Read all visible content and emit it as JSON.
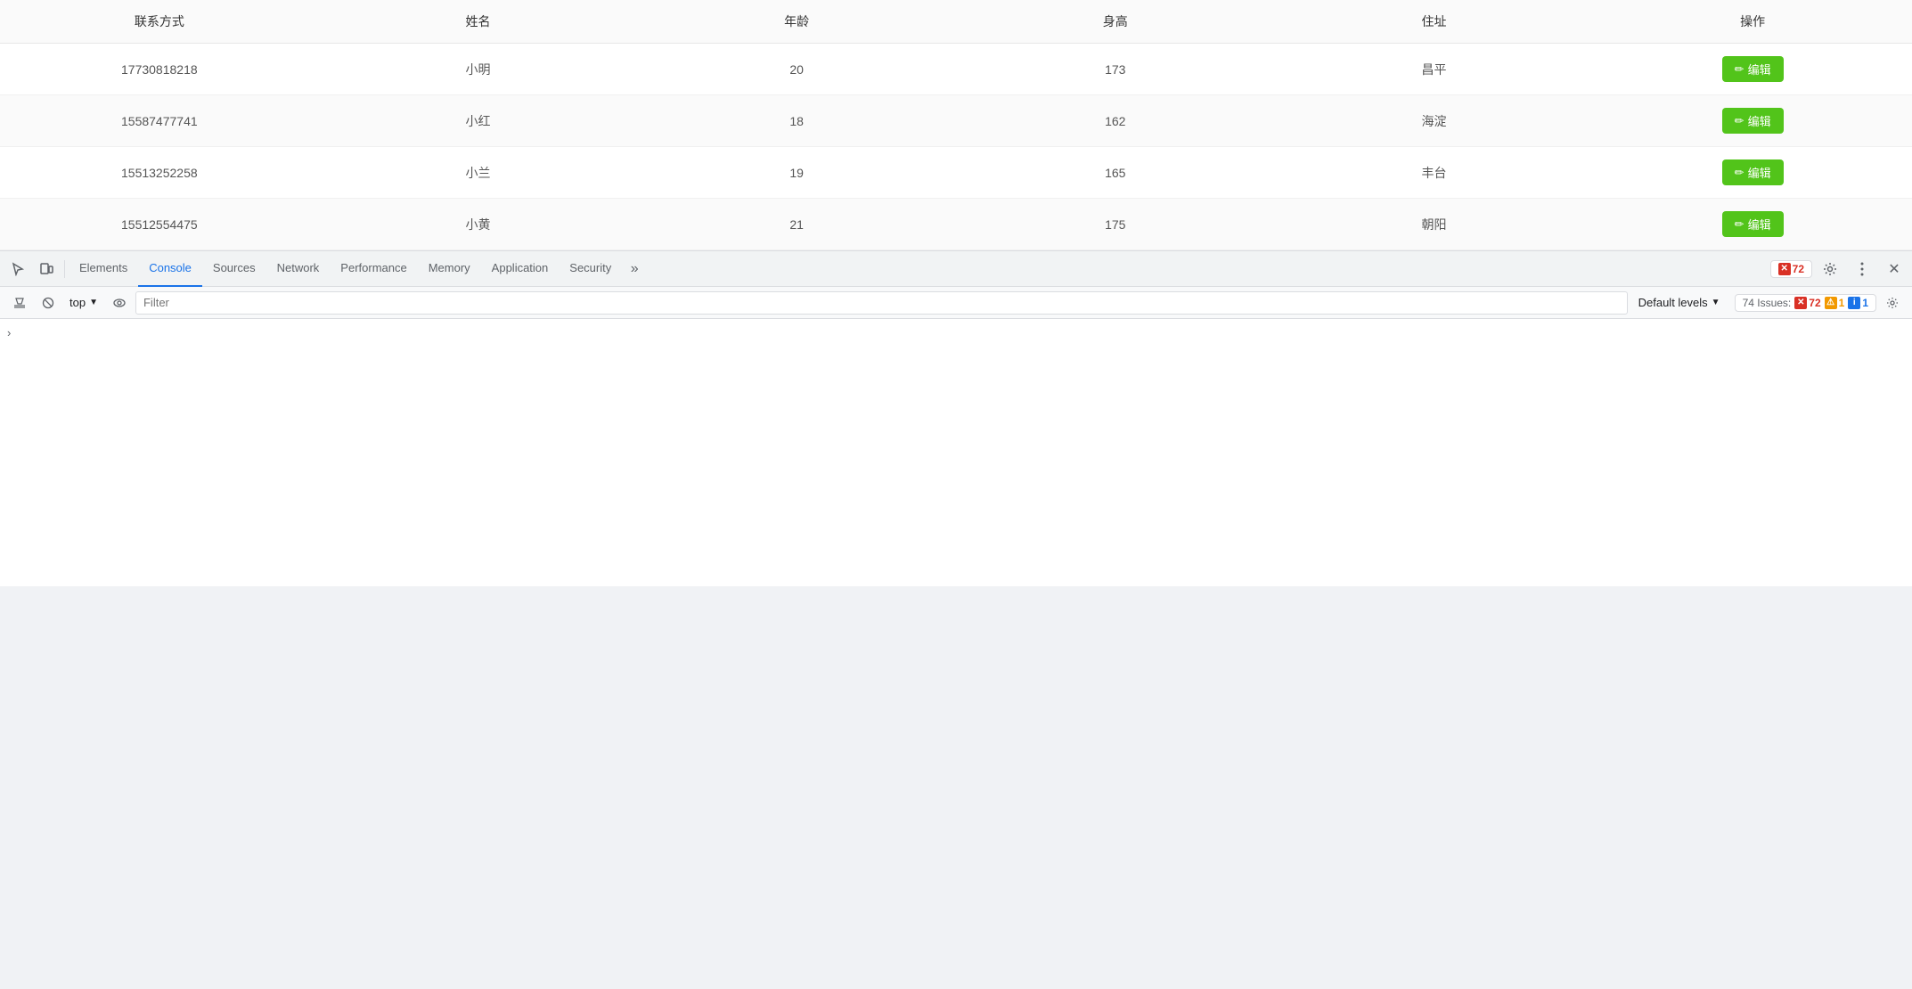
{
  "table": {
    "columns": [
      {
        "key": "contact",
        "label": "联系方式"
      },
      {
        "key": "name",
        "label": "姓名"
      },
      {
        "key": "age",
        "label": "年龄"
      },
      {
        "key": "height",
        "label": "身高"
      },
      {
        "key": "address",
        "label": "住址"
      },
      {
        "key": "action",
        "label": "操作"
      }
    ],
    "rows": [
      {
        "contact": "17730818218",
        "name": "小明",
        "age": "20",
        "height": "173",
        "address": "昌平",
        "action": "编辑"
      },
      {
        "contact": "15587477741",
        "name": "小红",
        "age": "18",
        "height": "162",
        "address": "海淀",
        "action": "编辑"
      },
      {
        "contact": "15513252258",
        "name": "小兰",
        "age": "19",
        "height": "165",
        "address": "丰台",
        "action": "编辑"
      },
      {
        "contact": "15512554475",
        "name": "小黄",
        "age": "21",
        "height": "175",
        "address": "朝阳",
        "action": "编辑"
      }
    ]
  },
  "devtools": {
    "tabs": [
      {
        "id": "elements",
        "label": "Elements",
        "active": false
      },
      {
        "id": "console",
        "label": "Console",
        "active": true
      },
      {
        "id": "sources",
        "label": "Sources",
        "active": false
      },
      {
        "id": "network",
        "label": "Network",
        "active": false
      },
      {
        "id": "performance",
        "label": "Performance",
        "active": false
      },
      {
        "id": "memory",
        "label": "Memory",
        "active": false
      },
      {
        "id": "application",
        "label": "Application",
        "active": false
      },
      {
        "id": "security",
        "label": "Security",
        "active": false
      }
    ],
    "issues_label": "74 Issues:",
    "error_count": "72",
    "warning_count": "1",
    "info_count": "1",
    "console_toolbar": {
      "context": "top",
      "filter_placeholder": "Filter",
      "levels_label": "Default levels"
    }
  }
}
